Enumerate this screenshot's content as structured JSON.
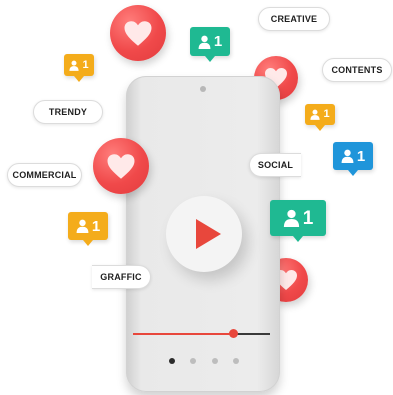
{
  "colors": {
    "accent_red": "#e8473c",
    "teal": "#1fb992",
    "orange": "#f4ac1b",
    "blue": "#1f95da"
  },
  "tags": {
    "creative": "CREATIVE",
    "contents": "CONTENTS",
    "trendy": "TRENDY",
    "social": "SOCIAL",
    "commercial": "COMMERCIAL",
    "graffic": "GRAFFIC"
  },
  "follower_badges": {
    "teal_top": "1",
    "orange_left_top": "1",
    "orange_right": "1",
    "blue_right": "1",
    "orange_left_mid": "1",
    "teal_big": "1"
  },
  "video": {
    "progress": 0.73,
    "active_page": 1,
    "page_count": 4
  },
  "icons": {
    "play": "play-icon",
    "heart": "heart-icon",
    "follower": "user-icon"
  }
}
